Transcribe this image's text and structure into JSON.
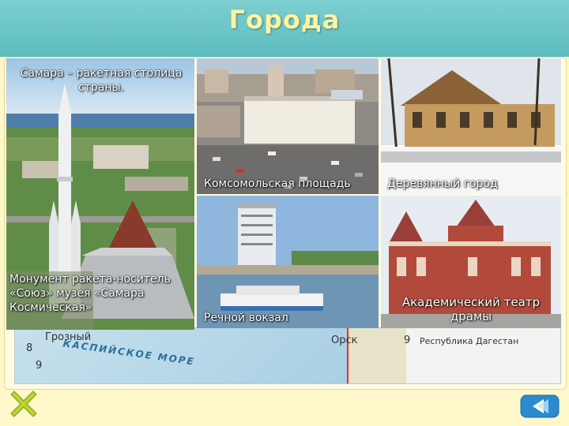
{
  "slide": {
    "title": "Города"
  },
  "photos": {
    "samara_caption_top": "Самара – ракетная столица страны.",
    "samara_caption_bottom": "Монумент ракета-носитель «Союз» музея «Самара Космическая»",
    "komsomolskaya_caption": "Комсомольская площадь",
    "wooden_city_caption": "Деревянный город",
    "river_station_caption": "Речной вокзал",
    "drama_theatre_caption": "Академический театр драмы"
  },
  "map": {
    "label_num_8": "8",
    "label_num_9": "9",
    "label_city_grozny": "Грозный",
    "label_sea": "КАСПИЙСКОЕ МОРЕ",
    "label_city_orsk": "Орск",
    "legend_num": "9",
    "legend_text": "Республика Дагестан"
  },
  "colors": {
    "header": "#5cbcbf",
    "title_text": "#fff3a0",
    "background": "#fdf7c9",
    "nav_green": "#b8d530",
    "nav_blue": "#2a8ccf"
  },
  "icons": {
    "close": "close-x-icon",
    "back": "back-arrow-icon"
  }
}
